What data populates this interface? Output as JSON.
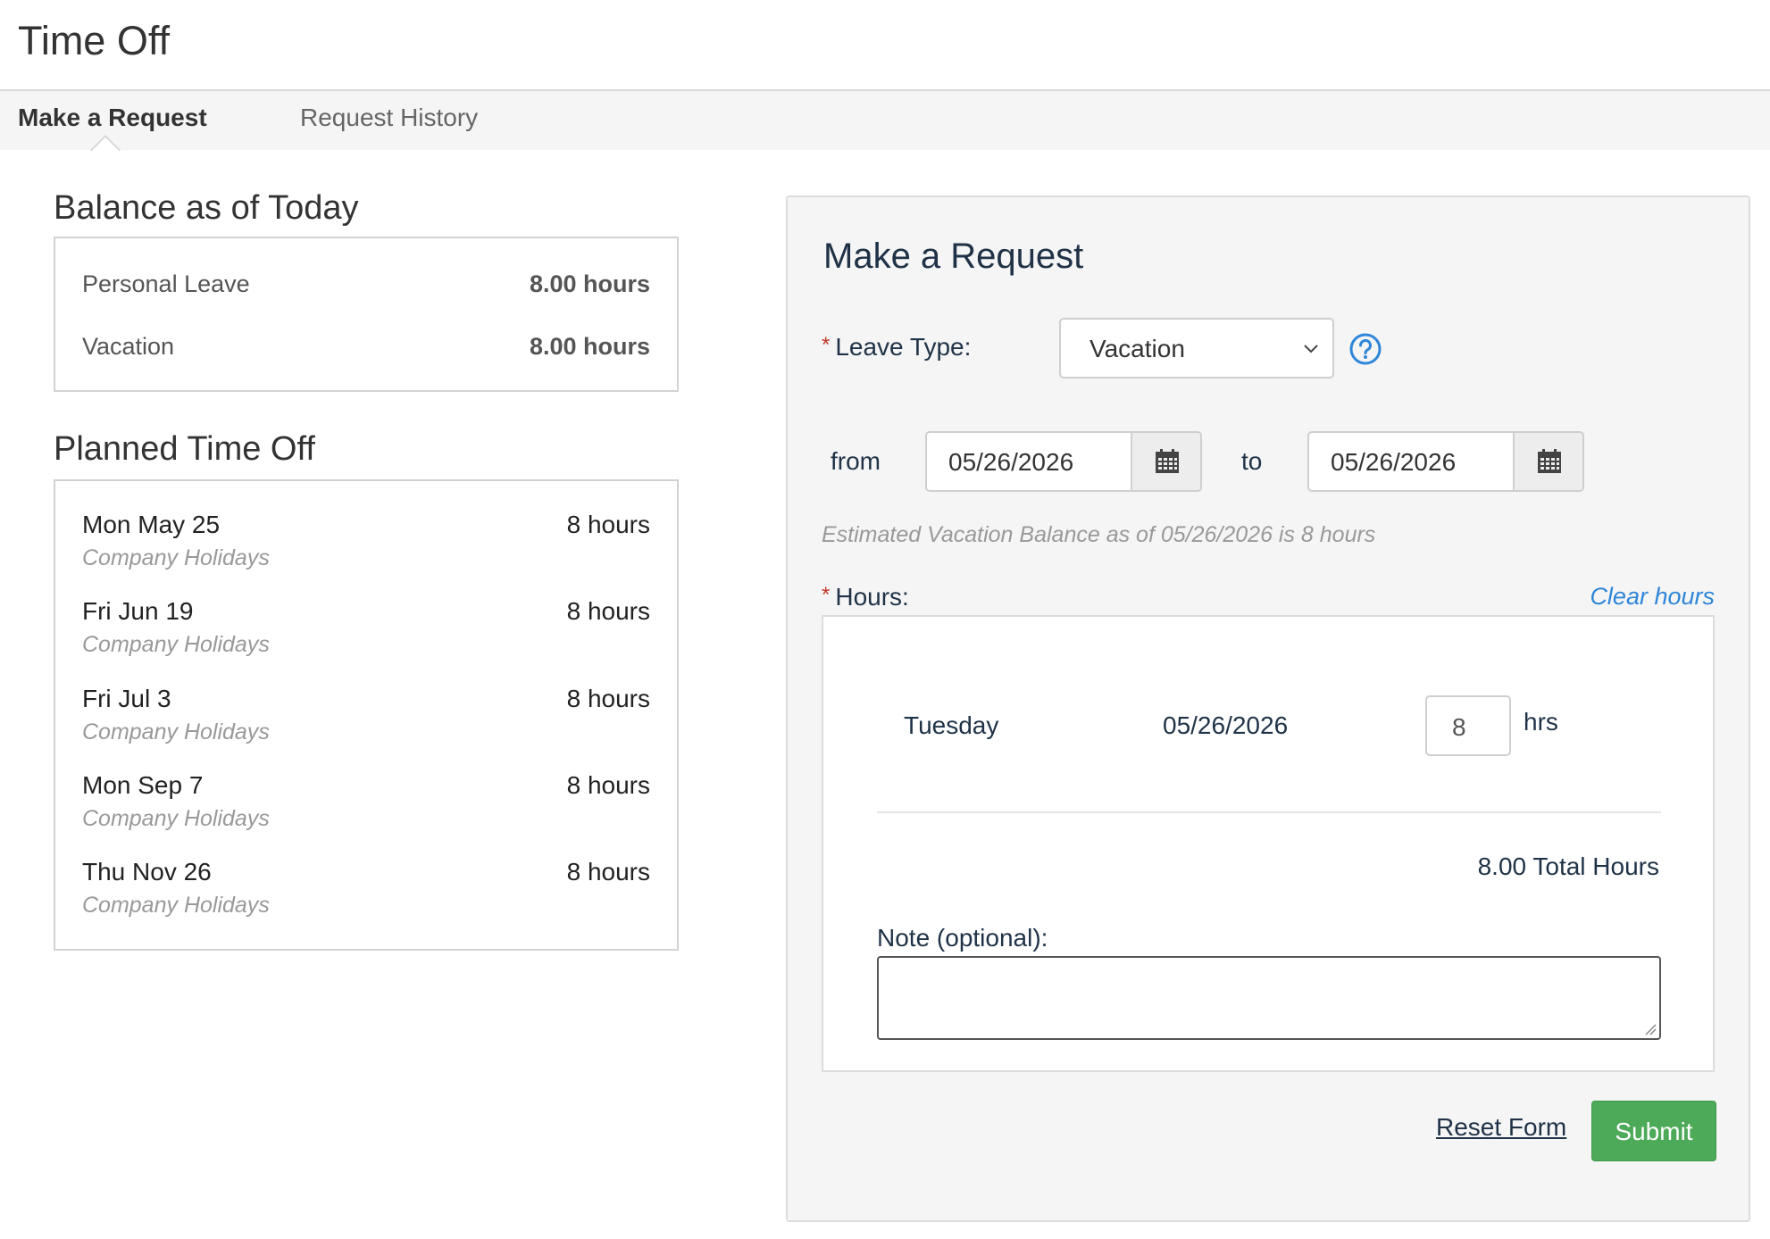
{
  "header": {
    "title": "Time Off"
  },
  "tabs": [
    {
      "label": "Make a Request",
      "active": true
    },
    {
      "label": "Request History",
      "active": false
    }
  ],
  "balance": {
    "title": "Balance as of Today",
    "rows": [
      {
        "label": "Personal Leave",
        "value": "8.00 hours"
      },
      {
        "label": "Vacation",
        "value": "8.00 hours"
      }
    ]
  },
  "planned": {
    "title": "Planned Time Off",
    "items": [
      {
        "date": "Mon May 25",
        "hours": "8 hours",
        "type": "Company Holidays"
      },
      {
        "date": "Fri Jun 19",
        "hours": "8 hours",
        "type": "Company Holidays"
      },
      {
        "date": "Fri Jul 3",
        "hours": "8 hours",
        "type": "Company Holidays"
      },
      {
        "date": "Mon Sep 7",
        "hours": "8 hours",
        "type": "Company Holidays"
      },
      {
        "date": "Thu Nov 26",
        "hours": "8 hours",
        "type": "Company Holidays"
      }
    ]
  },
  "request": {
    "title": "Make a Request",
    "required_marker": "*",
    "leave_type_label": "Leave Type:",
    "leave_type_value": "Vacation",
    "from_label": "from",
    "from_date": "05/26/2026",
    "to_label": "to",
    "to_date": "05/26/2026",
    "estimate": "Estimated Vacation Balance as of 05/26/2026 is 8 hours",
    "hours_label": "Hours:",
    "clear_hours": "Clear hours",
    "day": {
      "name": "Tuesday",
      "date": "05/26/2026",
      "hours": "8",
      "unit": "hrs"
    },
    "total": "8.00 Total Hours",
    "note_label": "Note (optional):",
    "note_value": "",
    "reset_label": "Reset Form",
    "submit_label": "Submit"
  },
  "colors": {
    "accent_link": "#2f86d8",
    "submit_green": "#4caa58",
    "required_red": "#c0392b",
    "heading_navy": "#1f3247"
  },
  "icons": [
    "chevron-down-icon",
    "help-icon",
    "calendar-icon"
  ]
}
